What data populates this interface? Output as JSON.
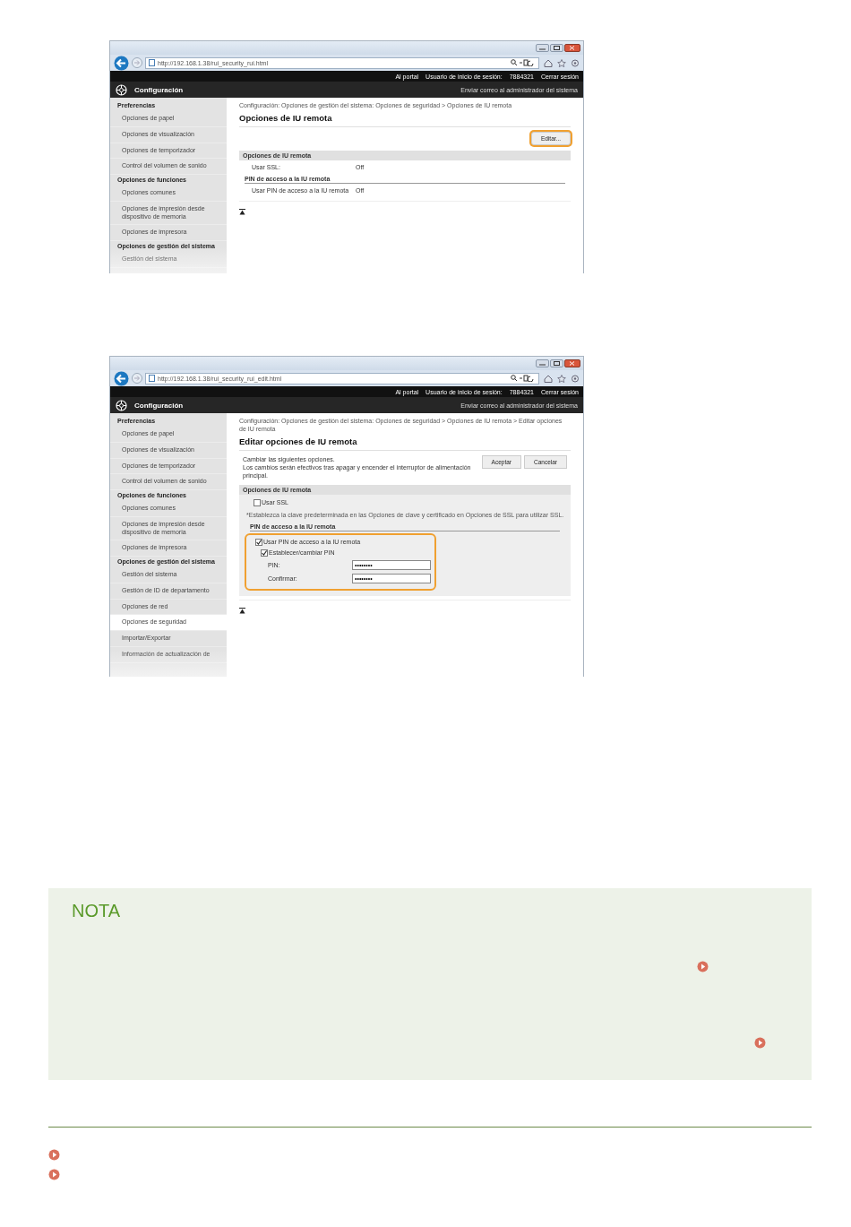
{
  "screenshots": [
    {
      "url": "http://192.168.1.38/rui_security_rui.html",
      "top_links": [
        "Al portal",
        "Usuario de inicio de sesión:",
        "7884321",
        "Cerrar sesión"
      ],
      "header": {
        "title": "Configuración",
        "link": "Enviar correo al administrador del sistema"
      },
      "sidebar": [
        {
          "kind": "header",
          "label": "Preferencias"
        },
        {
          "kind": "item",
          "label": "Opciones de papel",
          "selected": false
        },
        {
          "kind": "item",
          "label": "Opciones de visualización",
          "selected": false
        },
        {
          "kind": "item",
          "label": "Opciones de temporizador",
          "selected": false
        },
        {
          "kind": "item",
          "label": "Control del volumen de sonido",
          "selected": false
        },
        {
          "kind": "header",
          "label": "Opciones de funciones"
        },
        {
          "kind": "item",
          "label": "Opciones comunes",
          "selected": false
        },
        {
          "kind": "item",
          "label": "Opciones de impresión desde dispositivo de memoria",
          "selected": false
        },
        {
          "kind": "item",
          "label": "Opciones de impresora",
          "selected": false
        },
        {
          "kind": "header",
          "label": "Opciones de gestión del sistema"
        },
        {
          "kind": "item",
          "label": "Gestión del sistema",
          "selected": false
        }
      ],
      "content": [
        {
          "kind": "breadcrumb",
          "text": "Configuración: Opciones de gestión del sistema: Opciones de seguridad > Opciones de IU remota"
        },
        {
          "kind": "heading",
          "text": "Opciones de IU remota"
        },
        {
          "kind": "buttons",
          "buttons": [
            {
              "label": "Editar...",
              "highlighted": true
            }
          ]
        },
        {
          "kind": "section",
          "text": "Opciones de IU remota"
        },
        {
          "kind": "setting",
          "label": "Usar SSL:",
          "value": "Off"
        },
        {
          "kind": "subsection",
          "text": "PIN de acceso a la IU remota"
        },
        {
          "kind": "setting",
          "label": "Usar PIN de acceso a la IU remota",
          "value": "Off"
        },
        {
          "kind": "top"
        }
      ]
    },
    {
      "url": "http://192.168.1.38/rui_security_rui_edit.html",
      "top_links": [
        "Al portal",
        "Usuario de inicio de sesión:",
        "7884321",
        "Cerrar sesión"
      ],
      "header": {
        "title": "Configuración",
        "link": "Enviar correo al administrador del sistema"
      },
      "sidebar": [
        {
          "kind": "header",
          "label": "Preferencias"
        },
        {
          "kind": "item",
          "label": "Opciones de papel",
          "selected": false
        },
        {
          "kind": "item",
          "label": "Opciones de visualización",
          "selected": false
        },
        {
          "kind": "item",
          "label": "Opciones de temporizador",
          "selected": false
        },
        {
          "kind": "item",
          "label": "Control del volumen de sonido",
          "selected": false
        },
        {
          "kind": "header",
          "label": "Opciones de funciones"
        },
        {
          "kind": "item",
          "label": "Opciones comunes",
          "selected": false
        },
        {
          "kind": "item",
          "label": "Opciones de impresión desde dispositivo de memoria",
          "selected": false
        },
        {
          "kind": "item",
          "label": "Opciones de impresora",
          "selected": false
        },
        {
          "kind": "header",
          "label": "Opciones de gestión del sistema"
        },
        {
          "kind": "item",
          "label": "Gestión del sistema",
          "selected": false
        },
        {
          "kind": "item",
          "label": "Gestión de ID de departamento",
          "selected": false
        },
        {
          "kind": "item",
          "label": "Opciones de red",
          "selected": false
        },
        {
          "kind": "item",
          "label": "Opciones de seguridad",
          "selected": true
        },
        {
          "kind": "item",
          "label": "Importar/Exportar",
          "selected": false
        },
        {
          "kind": "item",
          "label": "Información de actualización de",
          "selected": false
        }
      ],
      "content": [
        {
          "kind": "breadcrumb",
          "text": "Configuración: Opciones de gestión del sistema: Opciones de seguridad > Opciones de IU remota > Editar opciones de IU remota"
        },
        {
          "kind": "heading",
          "text": "Editar opciones de IU remota"
        },
        {
          "kind": "intro",
          "lines": [
            "Cambiar las siguientes opciones.",
            "Los cambios serán efectivos tras apagar y encender el interruptor de alimentación principal."
          ],
          "buttons": [
            {
              "label": "Aceptar",
              "highlighted": false
            },
            {
              "label": "Cancelar",
              "highlighted": false
            }
          ]
        },
        {
          "kind": "panel",
          "title": "Opciones de IU remota",
          "items": [
            {
              "kind": "checkbox",
              "label": "Usar SSL",
              "checked": false
            },
            {
              "kind": "note",
              "text": "*Establezca la clave predeterminada en las Opciones de clave y certificado en Opciones de SSL para utilizar SSL."
            },
            {
              "kind": "subsection",
              "text": "PIN de acceso a la IU remota"
            },
            {
              "kind": "group",
              "highlighted": true,
              "items": [
                {
                  "kind": "checkbox",
                  "label": "Usar PIN de acceso a la IU remota",
                  "checked": true,
                  "children": [
                    {
                      "kind": "checkbox",
                      "label": "Establecer/cambiar PIN",
                      "checked": true,
                      "children": [
                        {
                          "kind": "password",
                          "label": "PIN:",
                          "value": "••••••••"
                        },
                        {
                          "kind": "password",
                          "label": "Confirmar:",
                          "value": "••••••••"
                        }
                      ]
                    }
                  ]
                }
              ]
            }
          ]
        },
        {
          "kind": "top"
        }
      ]
    }
  ],
  "note": {
    "title": "NOTA"
  }
}
